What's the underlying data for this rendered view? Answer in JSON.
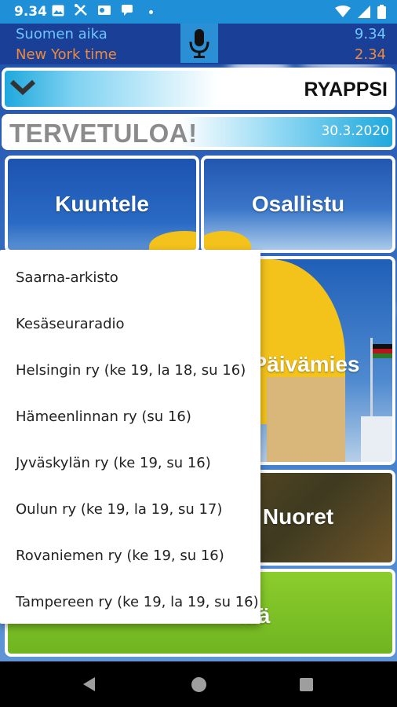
{
  "status_bar": {
    "time": "9.34",
    "icons": [
      "image-icon",
      "tools-icon",
      "outlook-icon",
      "chat-icon",
      "dot-icon",
      "wifi-icon",
      "signal-icon",
      "battery-icon"
    ]
  },
  "clocks": {
    "finland": {
      "label": "Suomen aika",
      "time": "9.34"
    },
    "newyork": {
      "label": "New York time",
      "time": "2.34"
    }
  },
  "header": {
    "app_title": "RYAPPSI",
    "welcome": "TERVETULOA!",
    "date": "30.3.2020"
  },
  "tiles": {
    "kuuntele": "Kuuntele",
    "osallistu": "Osallistu",
    "paivamies": "Päivämies",
    "nuoret": "Nuoret",
    "green": "illä"
  },
  "menu": {
    "items": [
      "Saarna-arkisto",
      "Kesäseuraradio",
      "Helsingin ry (ke 19, la 18, su 16)",
      "Hämeenlinnan ry (su 16)",
      "Jyväskylän ry (ke 19, su 16)",
      "Oulun ry (ke 19, la 19, su 17)",
      "Rovaniemen ry (ke 19, su 16)",
      "Tampereen ry (ke 19, la 19, su 16)"
    ]
  },
  "colors": {
    "status_bar": "#1f8fd8",
    "finland_time": "#6fc7ff",
    "newyork_time": "#ef8a3a",
    "accent_blue": "#1fa8dd",
    "green_tile": "#7cbf26"
  }
}
